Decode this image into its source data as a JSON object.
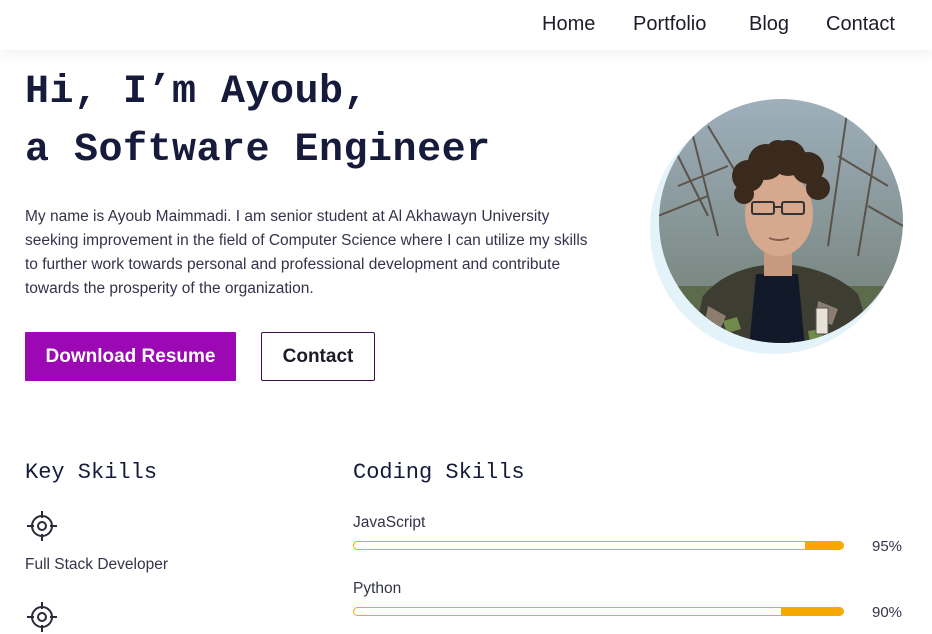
{
  "nav": {
    "links": [
      "Home",
      "Portfolio",
      "Blog",
      "Contact"
    ]
  },
  "hero": {
    "title_line1": "Hi, I’m Ayoub,",
    "title_line2": "a Software Engineer",
    "bio": "My name is Ayoub Maimmadi. I am senior student at Al Akhawayn University seeking improvement in the field of Computer Science where I can utilize my skills to further work towards personal and professional development and contribute towards the prosperity of the organization.",
    "primary_button": "Download Resume",
    "secondary_button": "Contact"
  },
  "key_skills": {
    "title": "Key Skills",
    "items": [
      {
        "label": "Full Stack Developer",
        "icon": "target-icon"
      },
      {
        "label": "",
        "icon": "target-icon"
      }
    ]
  },
  "coding_skills": {
    "title": "Coding Skills",
    "items": [
      {
        "name": "JavaScript",
        "percent_label": "95%",
        "level": 0.95
      },
      {
        "name": "Python",
        "percent_label": "90%",
        "level": 0.9
      }
    ]
  },
  "colors": {
    "accent": "#9c08b4",
    "heading": "#161b3b",
    "bar": "#f4a800"
  }
}
